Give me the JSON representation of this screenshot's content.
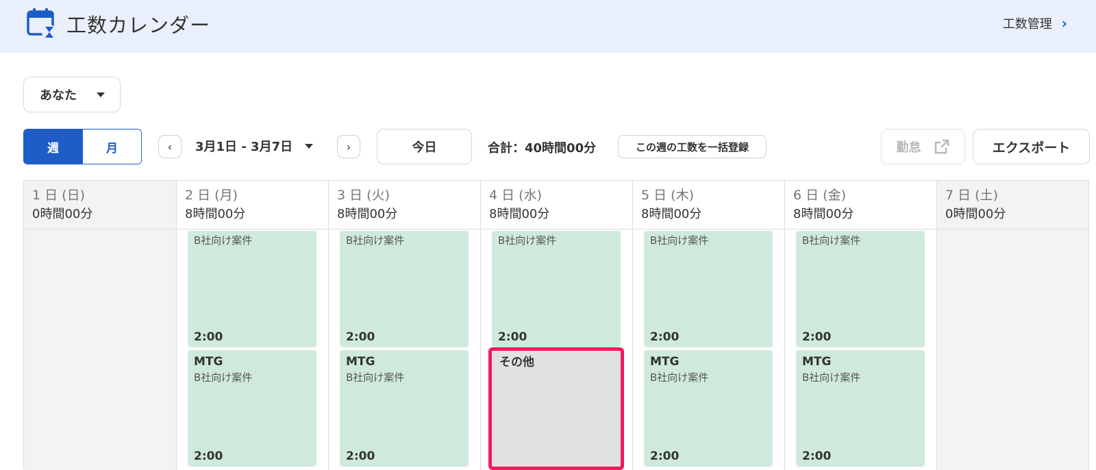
{
  "header": {
    "title": "工数カレンダー",
    "nav_link": "工数管理",
    "nav_chevron": "›",
    "icon": "calendar-hourglass-icon"
  },
  "toolbar": {
    "user_select": "あなた",
    "view_week": "週",
    "view_month": "月",
    "prev": "‹",
    "next": "›",
    "date_range": "3月1日 - 3月7日",
    "today": "今日",
    "total": "合計：40時間00分",
    "bulk_register": "この週の工数を一括登録",
    "kintai": "勤怠",
    "export": "エクスポート"
  },
  "colors": {
    "accent": "#1e5cc6",
    "header_bg": "#e9f0fb",
    "event_bg": "#cfeadb",
    "other_bg": "#e1e1e1",
    "highlight": "#ee1c5c"
  },
  "days": [
    {
      "name": "1 日 (日)",
      "hours": "0時間00分"
    },
    {
      "name": "2 日 (月)",
      "hours": "8時間00分"
    },
    {
      "name": "3 日 (火)",
      "hours": "8時間00分"
    },
    {
      "name": "4 日 (水)",
      "hours": "8時間00分"
    },
    {
      "name": "5 日 (木)",
      "hours": "8時間00分"
    },
    {
      "name": "6 日 (金)",
      "hours": "8時間00分"
    },
    {
      "name": "7 日 (土)",
      "hours": "0時間00分"
    }
  ],
  "events": {
    "project_label": "B社向け案件",
    "mtg_title": "MTG",
    "other_title": "その他",
    "duration": "2:00"
  }
}
